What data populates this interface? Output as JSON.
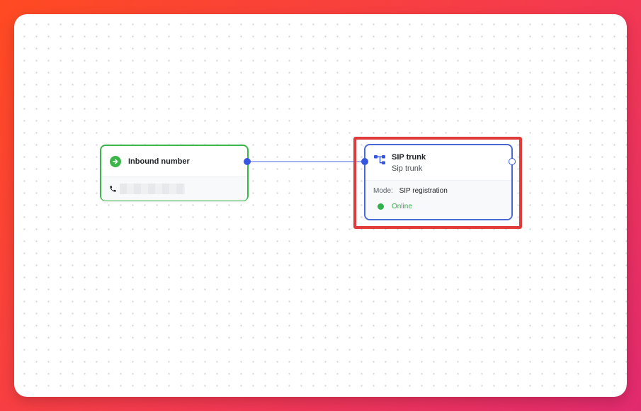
{
  "canvas": {
    "edges": [
      {
        "from": "inbound-number",
        "to": "sip-trunk"
      }
    ]
  },
  "inbound_node": {
    "title": "Inbound number",
    "icon": "arrow-right-circle-icon",
    "phone_icon": "phone-icon",
    "phone_number_redacted": true
  },
  "sip_node": {
    "title": "SIP trunk",
    "subtitle": "Sip trunk",
    "icon": "sip-trunk-icon",
    "mode_label": "Mode:",
    "mode_value": "SIP registration",
    "status": "Online",
    "highlighted": true
  },
  "colors": {
    "inbound_border": "#3cb64a",
    "sip_border": "#4a67d6",
    "handle": "#3556e0",
    "edge": "#6a84e6",
    "highlight": "#e03c3c",
    "status_online": "#2fb14b"
  }
}
